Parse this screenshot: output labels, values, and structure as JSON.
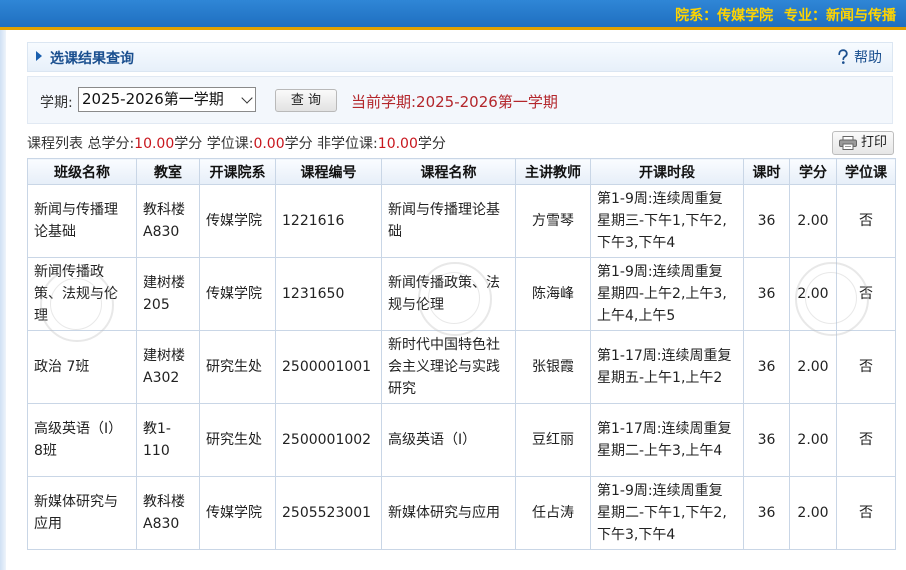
{
  "topbar": {
    "college": "院系：传媒学院",
    "major": "专业：新闻与传播"
  },
  "panel": {
    "title": "选课结果查询",
    "help": "帮助"
  },
  "filter": {
    "term_label": "学期:",
    "term_value": "2025-2026第一学期",
    "query_button": "查 询",
    "current_term": "当前学期:2025-2026第一学期"
  },
  "summary": {
    "prefix": "课程列表 总学分:",
    "total_value": "10.00",
    "unit1": "学分 学位课:",
    "degree_value": "0.00",
    "unit2": "学分 非学位课:",
    "nondegree_value": "10.00",
    "unit3": "学分"
  },
  "print_label": "打印",
  "columns": [
    "班级名称",
    "教室",
    "开课院系",
    "课程编号",
    "课程名称",
    "主讲教师",
    "开课时段",
    "课时",
    "学分",
    "学位课"
  ],
  "rows": [
    [
      "新闻与传播理论基础",
      "教科楼A830",
      "传媒学院",
      "1221616",
      "新闻与传播理论基础",
      "方雪琴",
      "第1-9周:连续周重复 星期三-下午1,下午2,下午3,下午4",
      "36",
      "2.00",
      "否"
    ],
    [
      "新闻传播政策、法规与伦理",
      "建树楼205",
      "传媒学院",
      "1231650",
      "新闻传播政策、法规与伦理",
      "陈海峰",
      "第1-9周:连续周重复 星期四-上午2,上午3,上午4,上午5",
      "36",
      "2.00",
      "否"
    ],
    [
      "政治 7班",
      "建树楼A302",
      "研究生处",
      "2500001001",
      "新时代中国特色社会主义理论与实践研究",
      "张银霞",
      "第1-17周:连续周重复 星期五-上午1,上午2",
      "36",
      "2.00",
      "否"
    ],
    [
      "高级英语（I）8班",
      "教1-110",
      "研究生处",
      "2500001002",
      "高级英语（I）",
      "豆红丽",
      "第1-17周:连续周重复 星期二-上午3,上午4",
      "36",
      "2.00",
      "否"
    ],
    [
      "新媒体研究与应用",
      "教科楼A830",
      "传媒学院",
      "2505523001",
      "新媒体研究与应用",
      "任占涛",
      "第1-9周:连续周重复 星期二-下午1,下午2,下午3,下午4",
      "36",
      "2.00",
      "否"
    ]
  ]
}
